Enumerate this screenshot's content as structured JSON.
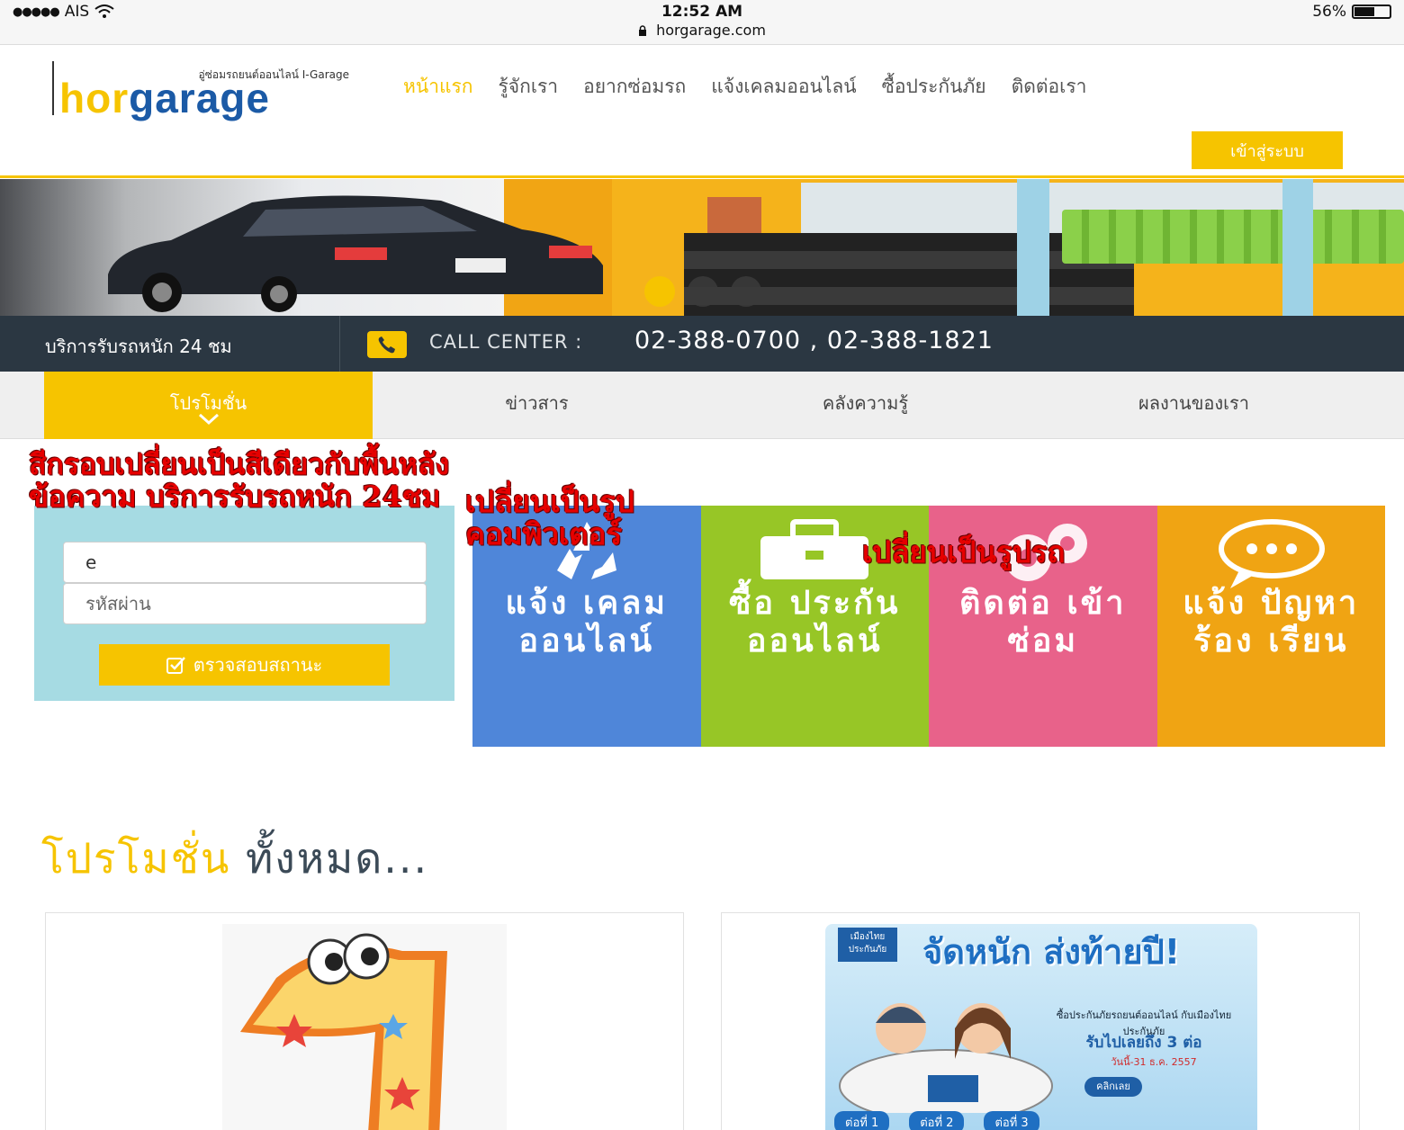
{
  "status_bar": {
    "carrier": "AIS",
    "signal_dots": "●●●●●",
    "time": "12:52 AM",
    "url": "horgarage.com",
    "battery_percent": "56%",
    "battery_level": 0.56
  },
  "header": {
    "logo_tagline": "อู่ซ่อมรถยนต์ออนไลน์ I-Garage",
    "logo_part1": "hor",
    "logo_part2": "garage",
    "nav": [
      "หน้าแรก",
      "รู้จักเรา",
      "อยากซ่อมรถ",
      "แจ้งเคลมออนไลน์",
      "ซื้อประกันภัย",
      "ติดต่อเรา"
    ],
    "login_button": "เข้าสู่ระบบ"
  },
  "hero": {
    "slide_count": 3,
    "active_slide": 1
  },
  "callbar": {
    "service_text": "บริการรับรถหนัก 24 ชม",
    "label": "CALL CENTER :",
    "numbers": "02-388-0700 , 02-388-1821"
  },
  "tabs": [
    "โปรโมชั่น",
    "ข่าวสาร",
    "คลังความรู้",
    "ผลงานของเรา"
  ],
  "login_panel": {
    "username_value": "e",
    "password_placeholder": "รหัสผ่าน",
    "check_button": "ตรวจสอบสถานะ"
  },
  "tiles": [
    {
      "title": "แจ้ง เคลม ออนไลน์",
      "color": "#4f86d9",
      "icon": "recycle-icon"
    },
    {
      "title": "ซื้อ ประกัน ออนไลน์",
      "color": "#97c626",
      "icon": "briefcase-icon"
    },
    {
      "title": "ติดต่อ เข้าซ่อม",
      "color": "#e8628a",
      "icon": "gears-icon"
    },
    {
      "title": "แจ้ง ปัญหา ร้อง เรียน",
      "color": "#f0a413",
      "icon": "chat-bubble-icon"
    }
  ],
  "annotations": {
    "note_1": "สีกรอบเปลี่ยนเป็นสีเดียวกับพื้นหลังข้อความ บริการรับรถหนัก 24ชม",
    "note_2": "เปลี่ยนเป็นรูปคอมพิวเตอร์",
    "note_3": "เปลี่ยนเป็นรูปรถ"
  },
  "promotions": {
    "heading_highlight": "โปรโมชั่น",
    "heading_rest": "ทั้งหมด...",
    "card_2": {
      "brand": "เมืองไทย ประกันภัย",
      "headline": "จัดหนัก ส่งท้ายปี!",
      "sub1": "ซื้อประกันภัยรถยนต์ออนไลน์ กับเมืองไทยประกันภัย",
      "sub2": "รับไปเลยถึง 3 ต่อ",
      "sub3": "วันนี้-31 ธ.ค. 2557",
      "cta": "คลิกเลย",
      "steps": [
        "ต่อที่ 1",
        "ต่อที่ 2",
        "ต่อที่ 3"
      ]
    }
  },
  "colors": {
    "brand_yellow": "#f6c400",
    "brand_blue": "#1b5aa6",
    "callbar_bg": "#2b3742",
    "panel_bg": "#a6dbe3",
    "annotation_red": "#e60000"
  }
}
